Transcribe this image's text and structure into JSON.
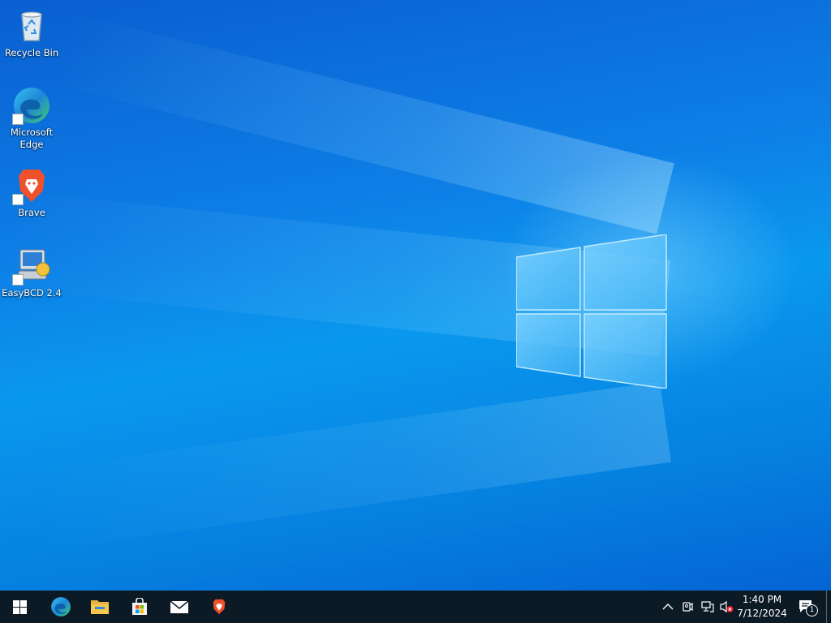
{
  "desktop": {
    "icons": [
      {
        "label": "Recycle Bin",
        "icon": "recycle-bin-icon"
      },
      {
        "label": "Microsoft Edge",
        "icon": "edge-icon"
      },
      {
        "label": "Brave",
        "icon": "brave-icon"
      },
      {
        "label": "EasyBCD 2.4",
        "icon": "easybcd-icon"
      }
    ]
  },
  "taskbar": {
    "start": "start-icon",
    "pinned": [
      {
        "name": "Microsoft Edge",
        "icon": "edge-icon"
      },
      {
        "name": "File Explorer",
        "icon": "folder-icon"
      },
      {
        "name": "Microsoft Store",
        "icon": "store-icon"
      },
      {
        "name": "Mail",
        "icon": "mail-icon"
      },
      {
        "name": "Brave",
        "icon": "brave-icon"
      }
    ],
    "tray": {
      "icons": [
        "chevron-up-icon",
        "meet-now-icon",
        "network-icon",
        "volume-muted-icon"
      ],
      "time": "1:40 PM",
      "date": "7/12/2024",
      "notification_count": "1"
    }
  },
  "colors": {
    "taskbar_bg": "#0c1a26",
    "desktop_accent": "#0a7fe6",
    "brave_orange": "#f0502a"
  }
}
